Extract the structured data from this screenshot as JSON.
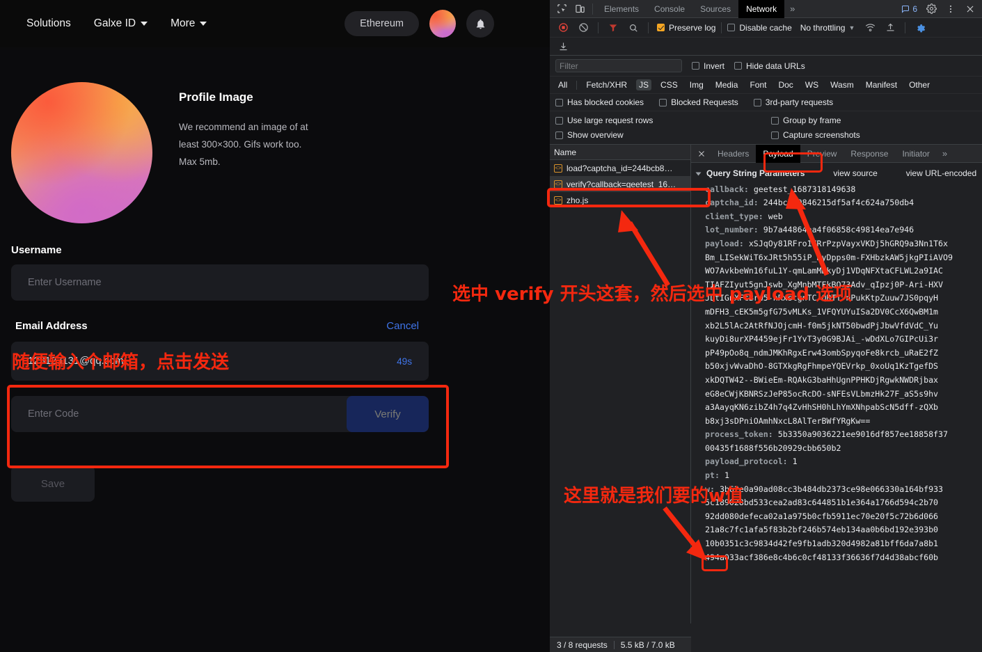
{
  "webpage": {
    "nav": {
      "links": [
        {
          "label": "Solutions",
          "caret": false
        },
        {
          "label": "Galxe ID",
          "caret": true
        },
        {
          "label": "More",
          "caret": true
        }
      ],
      "chain_pill": "Ethereum",
      "avatar_icon": "user-avatar",
      "bell_icon": "bell-icon"
    },
    "profile": {
      "title": "Profile Image",
      "description": "We recommend an image of at least 300×300. Gifs work too. Max 5mb."
    },
    "username": {
      "label": "Username",
      "placeholder": "Enter Username"
    },
    "email": {
      "label": "Email Address",
      "cancel_label": "Cancel",
      "value": "123123131@qq.com",
      "timer": "49s"
    },
    "code": {
      "placeholder": "Enter Code",
      "verify_label": "Verify"
    },
    "save_label": "Save"
  },
  "annotations": {
    "color": "#f4280f",
    "note_email": "随便输入个邮箱，点击发送",
    "note_verify": "选中 verify 开头这套，然后选中 payload 选项",
    "note_w": "这里就是我们要的w值"
  },
  "devtools": {
    "tabs": [
      {
        "label": "Elements",
        "active": false
      },
      {
        "label": "Console",
        "active": false
      },
      {
        "label": "Sources",
        "active": false
      },
      {
        "label": "Network",
        "active": true
      }
    ],
    "more_tabs": "»",
    "issues_count": "6",
    "icons": {
      "inspect": "inspect-element-icon",
      "device": "device-toolbar-icon",
      "settings": "gear-icon",
      "kebab": "more-options-icon",
      "close": "close-icon",
      "record": "record-stop-icon",
      "clear": "clear-network-icon",
      "filter": "filter-icon",
      "search": "search-icon",
      "wifi": "network-conditions-icon",
      "import": "import-har-icon",
      "export": "export-har-icon",
      "network_settings": "network-settings-gear-icon"
    },
    "toolbar": {
      "preserve_log": {
        "label": "Preserve log",
        "checked": true
      },
      "disable_cache": {
        "label": "Disable cache",
        "checked": false
      },
      "throttling": "No throttling"
    },
    "filter": {
      "placeholder": "Filter",
      "invert": {
        "label": "Invert",
        "checked": false
      },
      "hide_data_urls": {
        "label": "Hide data URLs",
        "checked": false
      }
    },
    "types": [
      {
        "label": "All",
        "active": false
      },
      {
        "label": "Fetch/XHR",
        "active": false
      },
      {
        "label": "JS",
        "active": true
      },
      {
        "label": "CSS",
        "active": false
      },
      {
        "label": "Img",
        "active": false
      },
      {
        "label": "Media",
        "active": false
      },
      {
        "label": "Font",
        "active": false
      },
      {
        "label": "Doc",
        "active": false
      },
      {
        "label": "WS",
        "active": false
      },
      {
        "label": "Wasm",
        "active": false
      },
      {
        "label": "Manifest",
        "active": false
      },
      {
        "label": "Other",
        "active": false
      }
    ],
    "options_row": [
      {
        "label": "Has blocked cookies",
        "checked": false
      },
      {
        "label": "Blocked Requests",
        "checked": false
      },
      {
        "label": "3rd-party requests",
        "checked": false
      }
    ],
    "display_options": [
      {
        "label": "Use large request rows",
        "checked": false
      },
      {
        "label": "Group by frame",
        "checked": false
      },
      {
        "label": "Show overview",
        "checked": false
      },
      {
        "label": "Capture screenshots",
        "checked": false
      }
    ],
    "requests": {
      "column_header": "Name",
      "rows": [
        {
          "name": "load?captcha_id=244bcb8…",
          "selected": false
        },
        {
          "name": "verify?callback=geetest_16…",
          "selected": true
        },
        {
          "name": "zho.js",
          "selected": false
        }
      ]
    },
    "detail_tabs": [
      {
        "label": "Headers",
        "active": false
      },
      {
        "label": "Payload",
        "active": true
      },
      {
        "label": "Preview",
        "active": false
      },
      {
        "label": "Response",
        "active": false
      },
      {
        "label": "Initiator",
        "active": false
      }
    ],
    "detail_more": "»",
    "payload": {
      "section_title": "Query String Parameters",
      "view_source": "view source",
      "view_url_encoded": "view URL-encoded",
      "params": [
        {
          "key": "callback:",
          "value": "geetest_1687318149638"
        },
        {
          "key": "captcha_id:",
          "value": "244bcb89846215df5af4c624a750db4"
        },
        {
          "key": "client_type:",
          "value": "web"
        },
        {
          "key": "lot_number:",
          "value": "9b7a44864aa4f06858c49814ea7e946"
        }
      ],
      "payload_key": "payload:",
      "payload_lines": [
        "xSJqOy81RFro17RrPzpVayxVKDj5hGRQ9a3Nn1T6x",
        "Bm_LISekWiT6xJRt5h55iP_HyDpps0m-FXHbzkAW5jkgPIiAVO9",
        "WO7AvkbeWn16fuL1Y-qmLamMDkyDj1VDqNFXtaCFLWL2a9IAC",
        "TIAFZIyut5gnJswb_XgMnbMTFkBQ73Adv_qIpzj0P-Ari-HXV",
        "JLtIGnXFcBrw5-nRxstgnTC-QRTT-nPukKtpZuuw7JS0pqyH",
        "mDFH3_cEK5m5gfG75vMLKs_1VFQYUYuISa2DV0CcX6QwBM1m",
        "xb2L5lAc2AtRfNJOjcmH-f0m5jkNT50bwdPjJbwVfdVdC_Yu",
        "kuyDi8urXP4459ejFr1YvT3y0G9BJAi_-wDdXLo7GIPcUi3r",
        "pP49pOo8q_ndmJMKhRgxErw43ombSpyqoFe8krcb_uRaE2fZ",
        "b50xjvWvaDhO-8GTXkgRgFhmpeYQEVrkp_0xoUq1KzTgefDS",
        "xkDQTW42--BWieEm-RQAkG3baHhUgnPPHKDjRgwkNWDRjbax",
        "eG8eCWjKBNRSzJeP85ocRcDO-sNFEsVLbmzHk27F_aS5s9hv",
        "a3AayqKN6zibZ4h7q4ZvHhSH0hLhYmXNhpabScN5dff-zQXb",
        "b8xj3sDPniOAmhNxcL8AlTerBWfYRgKw=="
      ],
      "process_token_key": "process_token:",
      "process_token_lines": [
        "5b3350a9036221ee9016df857ee18858f37",
        "00435f1688f556b20929cbb650b2"
      ],
      "payload_protocol": {
        "key": "payload_protocol:",
        "value": "1"
      },
      "pt": {
        "key": "pt:",
        "value": "1"
      },
      "w_key": "w:",
      "w_lines": [
        "3b62e0a90ad08cc3b484db2373ce98e066330a164bf933",
        "5c189028bd533cea2ad83c644851b1e364a1766d594c2b70",
        "92dd080defeca02a1a975b0cfb5911ec70e20f5c72b6d066",
        "21a8c7fc1afa5f83b2bf246b574eb134aa0b6bd192e393b0",
        "10b0351c3c9834d42fe9fb1adb320d4982a81bff6da7a8b1",
        "494a033acf386e8c4b6c0cf48133f36636f7d4d38abcf60b"
      ]
    },
    "status_bar": {
      "requests": "3 / 8 requests",
      "transferred": "5.5 kB / 7.0 kB"
    }
  }
}
